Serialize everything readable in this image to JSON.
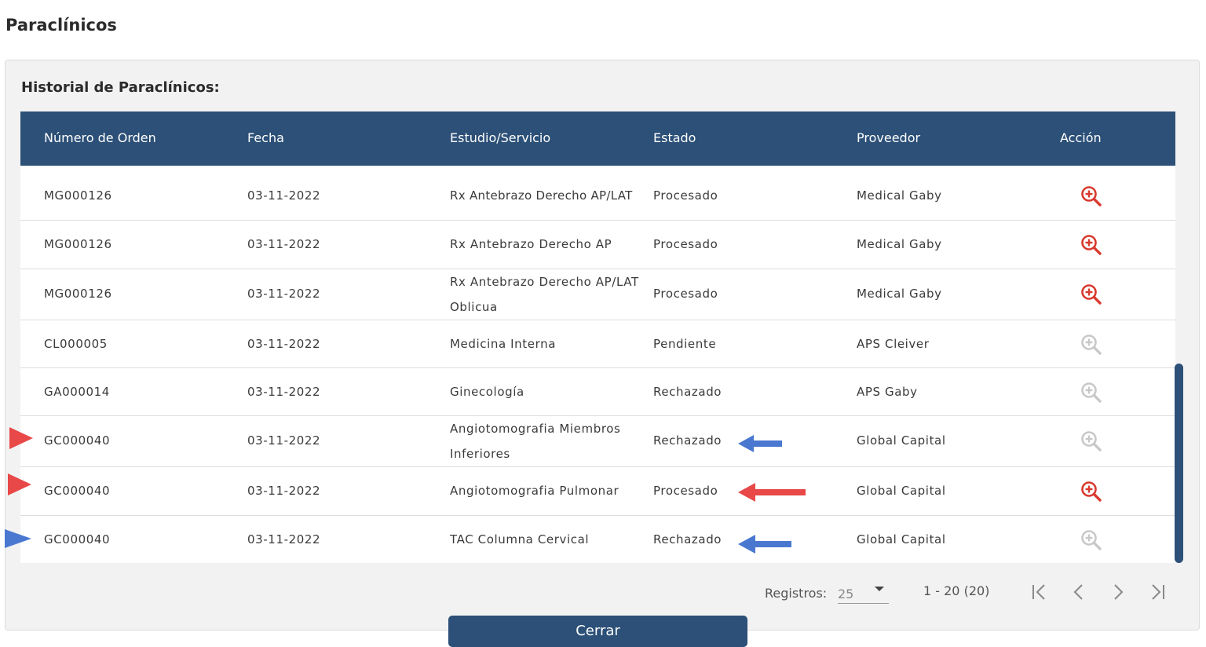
{
  "page": {
    "title": "Paraclínicos"
  },
  "section": {
    "title": "Historial de Paraclínicos:"
  },
  "table": {
    "headers": [
      "Número de Orden",
      "Fecha",
      "Estudio/Servicio",
      "Estado",
      "Proveedor",
      "Acción"
    ],
    "rows": [
      {
        "order": "MG000126",
        "date": "03-11-2022",
        "study": "Rx Antebrazo Derecho AP/LAT",
        "status": "Procesado",
        "provider": "Medical Gaby",
        "action_enabled": true
      },
      {
        "order": "MG000126",
        "date": "03-11-2022",
        "study": "Rx Antebrazo Derecho AP",
        "status": "Procesado",
        "provider": "Medical Gaby",
        "action_enabled": true
      },
      {
        "order": "MG000126",
        "date": "03-11-2022",
        "study": "Rx Antebrazo Derecho AP/LAT Oblicua",
        "status": "Procesado",
        "provider": "Medical Gaby",
        "action_enabled": true
      },
      {
        "order": "CL000005",
        "date": "03-11-2022",
        "study": "Medicina Interna",
        "status": "Pendiente",
        "provider": "APS Cleiver",
        "action_enabled": false
      },
      {
        "order": "GA000014",
        "date": "03-11-2022",
        "study": "Ginecología",
        "status": "Rechazado",
        "provider": "APS Gaby",
        "action_enabled": false
      },
      {
        "order": "GC000040",
        "date": "03-11-2022",
        "study": "Angiotomografia Miembros Inferiores",
        "status": "Rechazado",
        "provider": "Global Capital",
        "action_enabled": false
      },
      {
        "order": "GC000040",
        "date": "03-11-2022",
        "study": "Angiotomografia Pulmonar",
        "status": "Procesado",
        "provider": "Global Capital",
        "action_enabled": true
      },
      {
        "order": "GC000040",
        "date": "03-11-2022",
        "study": "TAC Columna Cervical",
        "status": "Rechazado",
        "provider": "Global Capital",
        "action_enabled": false
      }
    ]
  },
  "pagination": {
    "label": "Registros:",
    "page_size": "25",
    "range": "1 - 20 (20)"
  },
  "footer": {
    "close_label": "Cerrar"
  },
  "icons": {
    "action_enabled": "zoom-in-icon",
    "action_disabled": "zoom-in-disabled-icon",
    "first": "first-page-icon",
    "prev": "prev-page-icon",
    "next": "next-page-icon",
    "last": "last-page-icon"
  },
  "colors": {
    "header_bg": "#2c5077",
    "action_enabled": "#d9392e",
    "action_disabled": "#c8c8c8",
    "annotation_red": "#e84848",
    "annotation_blue": "#4a78d0"
  }
}
